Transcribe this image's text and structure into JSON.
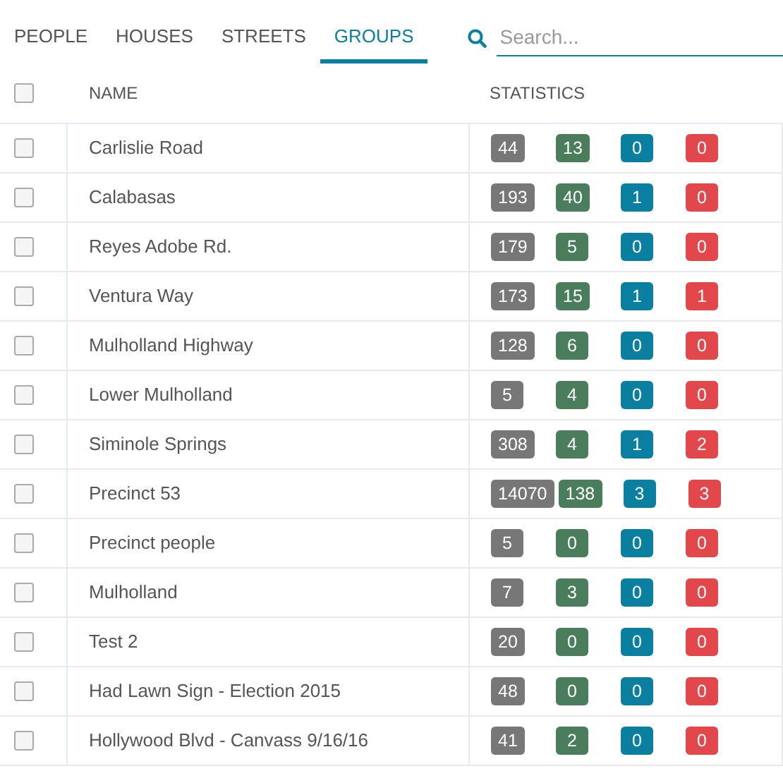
{
  "tabs": [
    {
      "label": "PEOPLE",
      "selected": false
    },
    {
      "label": "HOUSES",
      "selected": false
    },
    {
      "label": "STREETS",
      "selected": false
    },
    {
      "label": "GROUPS",
      "selected": true
    }
  ],
  "search": {
    "placeholder": "Search..."
  },
  "table": {
    "select_all": {
      "checked": false
    },
    "columns": [
      "NAME",
      "STATISTICS"
    ],
    "rows": [
      {
        "checked": false,
        "name": "Carlislie Road",
        "stats": [
          "44",
          "13",
          "0",
          "0"
        ]
      },
      {
        "checked": false,
        "name": "Calabasas",
        "stats": [
          "193",
          "40",
          "1",
          "0"
        ]
      },
      {
        "checked": false,
        "name": "Reyes Adobe Rd.",
        "stats": [
          "179",
          "5",
          "0",
          "0"
        ]
      },
      {
        "checked": false,
        "name": "Ventura Way",
        "stats": [
          "173",
          "15",
          "1",
          "1"
        ]
      },
      {
        "checked": false,
        "name": "Mulholland Highway",
        "stats": [
          "128",
          "6",
          "0",
          "0"
        ]
      },
      {
        "checked": false,
        "name": "Lower Mulholland",
        "stats": [
          "5",
          "4",
          "0",
          "0"
        ]
      },
      {
        "checked": false,
        "name": "Siminole Springs",
        "stats": [
          "308",
          "4",
          "1",
          "2"
        ]
      },
      {
        "checked": false,
        "name": "Precinct 53",
        "stats": [
          "14070",
          "138",
          "3",
          "3"
        ]
      },
      {
        "checked": false,
        "name": "Precinct people",
        "stats": [
          "5",
          "0",
          "0",
          "0"
        ]
      },
      {
        "checked": false,
        "name": "Mulholland",
        "stats": [
          "7",
          "3",
          "0",
          "0"
        ]
      },
      {
        "checked": false,
        "name": "Test 2",
        "stats": [
          "20",
          "0",
          "0",
          "0"
        ]
      },
      {
        "checked": false,
        "name": "Had Lawn Sign - Election 2015",
        "stats": [
          "48",
          "0",
          "0",
          "0"
        ]
      },
      {
        "checked": false,
        "name": "Hollywood Blvd - Canvass 9/16/16",
        "stats": [
          "41",
          "2",
          "0",
          "0"
        ]
      }
    ]
  }
}
